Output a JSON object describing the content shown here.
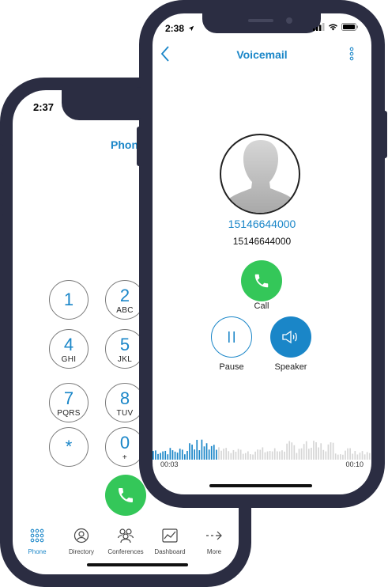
{
  "back_phone": {
    "status_time": "2:37",
    "title": "Phon",
    "keypad": [
      {
        "digit": "1",
        "letters": ""
      },
      {
        "digit": "2",
        "letters": "ABC"
      },
      {
        "digit": "4",
        "letters": "GHI"
      },
      {
        "digit": "5",
        "letters": "JKL"
      },
      {
        "digit": "7",
        "letters": "PQRS"
      },
      {
        "digit": "8",
        "letters": "TUV"
      },
      {
        "digit": "*",
        "letters": ""
      },
      {
        "digit": "0",
        "letters": "+"
      }
    ],
    "tabs": [
      {
        "label": "Phone",
        "icon": "dialpad-icon",
        "active": true
      },
      {
        "label": "Directory",
        "icon": "contact-icon",
        "active": false
      },
      {
        "label": "Conferences",
        "icon": "group-icon",
        "active": false
      },
      {
        "label": "Dashboard",
        "icon": "chart-icon",
        "active": false
      },
      {
        "label": "More",
        "icon": "arrow-more-icon",
        "active": false
      }
    ]
  },
  "front_phone": {
    "status_time": "2:38",
    "title": "Voicemail",
    "caller_number_link": "15146644000",
    "caller_number": "15146644000",
    "call_label": "Call",
    "pause_label": "Pause",
    "speaker_label": "Speaker",
    "elapsed": "00:03",
    "duration": "00:10",
    "playback_progress": 0.3
  },
  "colors": {
    "frame": "#2b2d42",
    "accent": "#1a86c8",
    "call_green": "#34c759",
    "speaker_blue": "#1a86c8"
  }
}
